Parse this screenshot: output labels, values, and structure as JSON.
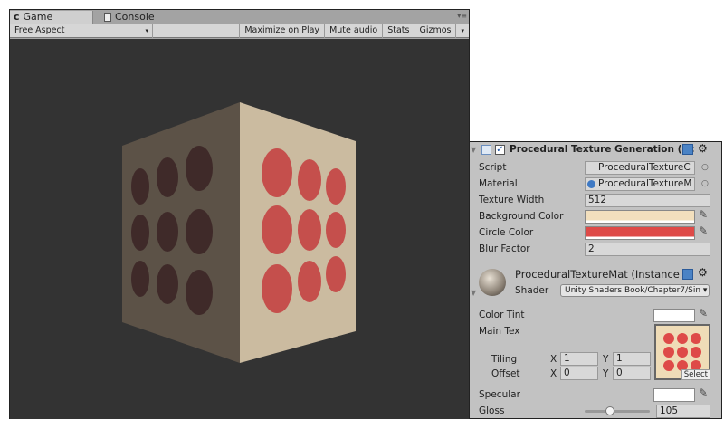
{
  "tabs": {
    "game": "Game",
    "console": "Console",
    "menu": "▾≡"
  },
  "toolbar": {
    "aspect": "Free Aspect",
    "maximize": "Maximize on Play",
    "mute": "Mute audio",
    "stats": "Stats",
    "gizmos": "Gizmos",
    "dropdown": "▾"
  },
  "component": {
    "title": "Procedural Texture Generation (Sc",
    "enabled": true,
    "fields": [
      {
        "label": "Script",
        "value": "ProceduralTextureC"
      },
      {
        "label": "Material",
        "value": "ProceduralTextureM"
      },
      {
        "label": "Texture Width",
        "value": "512"
      },
      {
        "label": "Background Color",
        "color": "#f2dfbd"
      },
      {
        "label": "Circle Color",
        "color": "#de4a48"
      },
      {
        "label": "Blur Factor",
        "value": "2"
      }
    ]
  },
  "material": {
    "title": "ProceduralTextureMat (Instance",
    "shader_label": "Shader",
    "shader": "Unity Shaders Book/Chapter7/Sin",
    "color_tint_label": "Color Tint",
    "color_tint": "#ffffff",
    "main_tex_label": "Main Tex",
    "tiling_label": "Tiling",
    "offset_label": "Offset",
    "tiling_x": "1",
    "tiling_y": "1",
    "offset_x": "0",
    "offset_y": "0",
    "x": "X",
    "y": "Y",
    "select": "Select",
    "specular_label": "Specular",
    "specular": "#ffffff",
    "gloss_label": "Gloss",
    "gloss": "105",
    "gloss_fraction": 0.39
  }
}
